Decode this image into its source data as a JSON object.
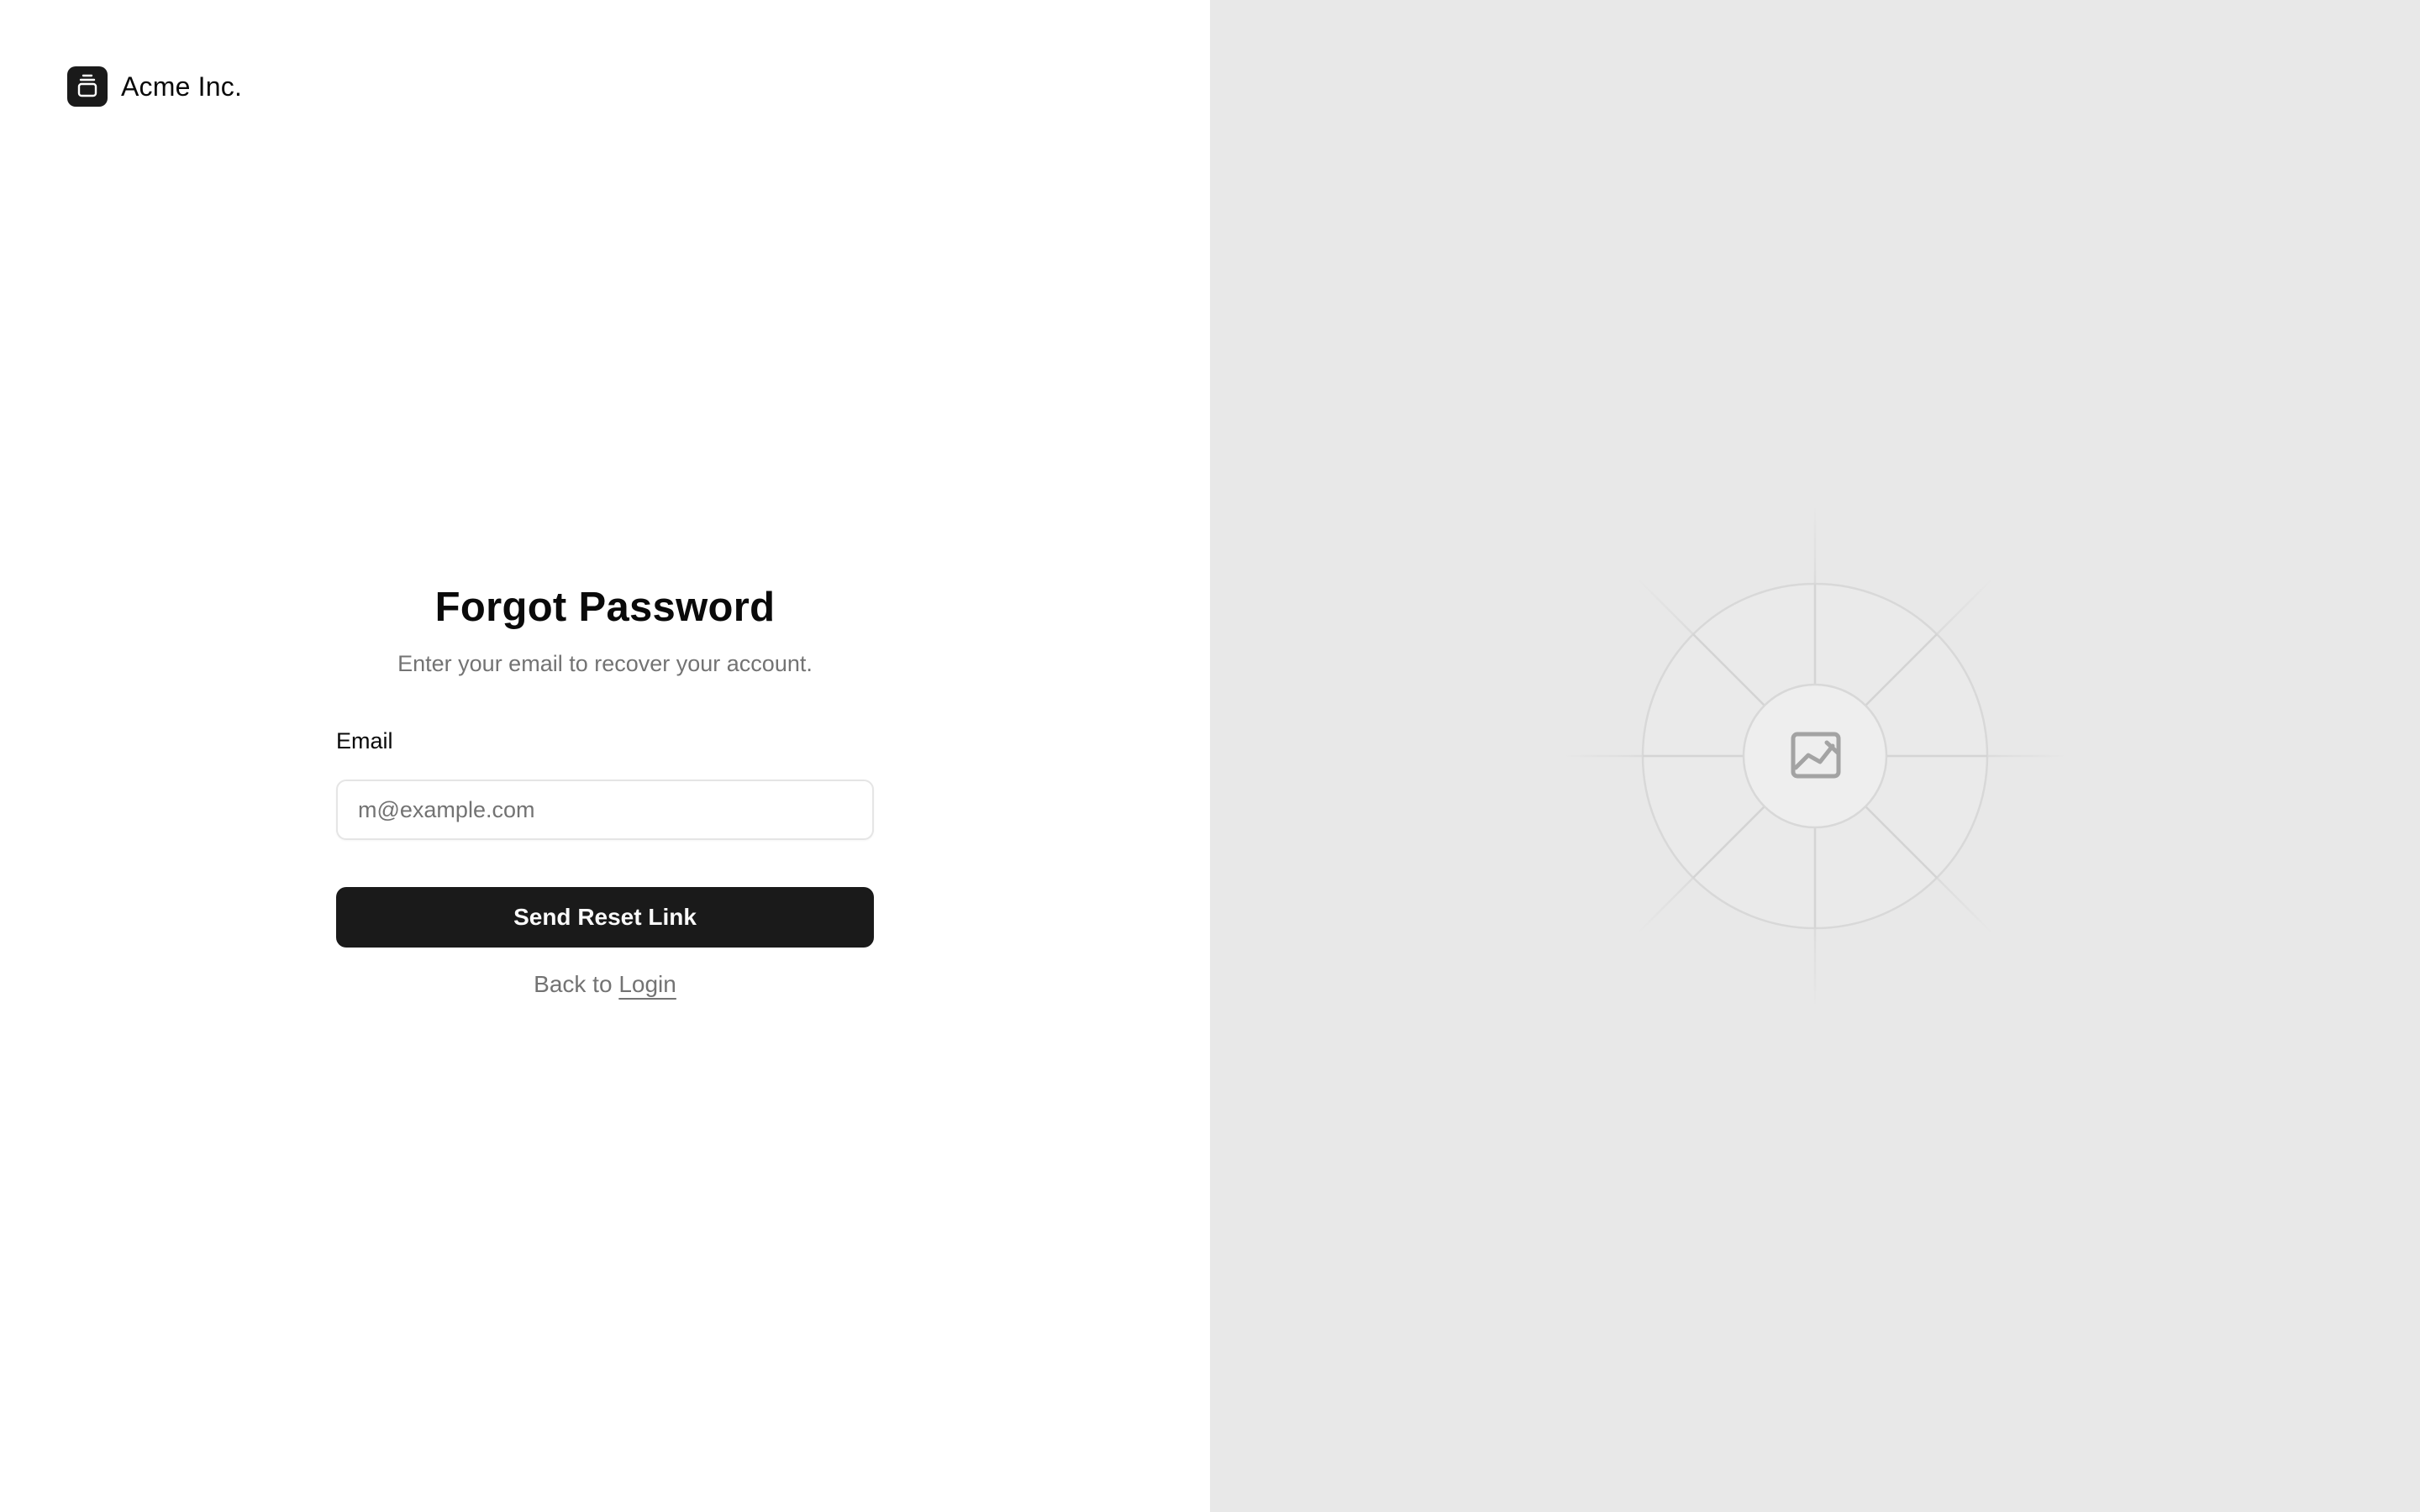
{
  "brand": {
    "name": "Acme Inc.",
    "logo_icon": "stacked-box-icon"
  },
  "form": {
    "title": "Forgot Password",
    "subtitle": "Enter your email to recover your account.",
    "email_label": "Email",
    "email_placeholder": "m@example.com",
    "email_value": "",
    "submit_label": "Send Reset Link",
    "back_prefix": "Back to",
    "back_link_label": "Login"
  },
  "hero": {
    "icon": "image-placeholder-icon",
    "background_color": "#e8e8e8"
  },
  "colors": {
    "primary": "#1a1a1a",
    "muted_text": "#737373",
    "border": "#e5e5e5"
  }
}
